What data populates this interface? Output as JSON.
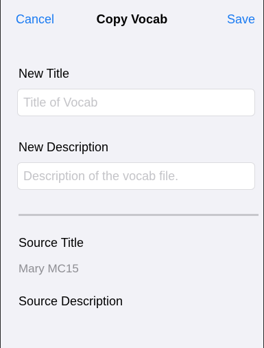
{
  "nav": {
    "cancel_label": "Cancel",
    "title": "Copy Vocab",
    "save_label": "Save"
  },
  "form": {
    "new_title": {
      "label": "New Title",
      "value": "",
      "placeholder": "Title of Vocab"
    },
    "new_description": {
      "label": "New Description",
      "value": "",
      "placeholder": "Description of the vocab file."
    }
  },
  "source": {
    "title_label": "Source Title",
    "title_value": "Mary MC15",
    "description_label": "Source Description"
  },
  "colors": {
    "accent": "#1a7bf2",
    "background": "#f2f2f7",
    "secondary_text": "#8e8e93",
    "placeholder_text": "#c4c4c8",
    "divider": "#c7c7cc"
  }
}
